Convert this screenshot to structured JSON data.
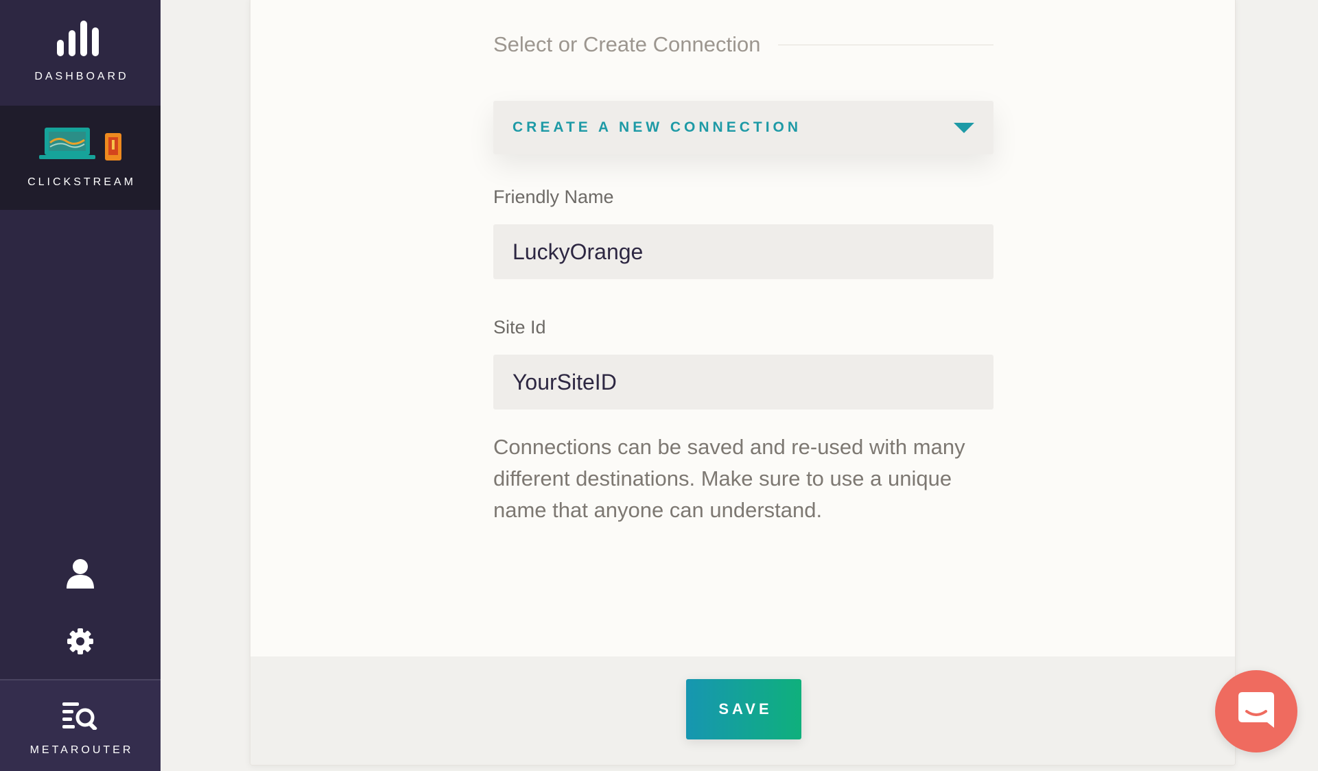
{
  "sidebar": {
    "items": [
      {
        "label": "DASHBOARD",
        "icon": "bar-chart-icon"
      },
      {
        "label": "CLICKSTREAM",
        "icon": "laptop-phone-icon",
        "active": true
      }
    ],
    "utility_icons": [
      "user-icon",
      "gear-icon"
    ],
    "footer": {
      "label": "METAROUTER",
      "icon": "list-search-icon"
    }
  },
  "form": {
    "section_title": "Select or Create Connection",
    "connection_select": {
      "value": "CREATE A NEW CONNECTION"
    },
    "friendly_name": {
      "label": "Friendly Name",
      "value": "LuckyOrange"
    },
    "site_id": {
      "label": "Site Id",
      "value": "YourSiteID"
    },
    "help_text": "Connections can be saved and re-used with many different destinations. Make sure to use a unique name that anyone can understand."
  },
  "footer": {
    "save_label": "SAVE"
  },
  "chat": {
    "icon": "chat-bubble-icon"
  },
  "colors": {
    "sidebar": "#2d2742",
    "sidebar_active": "#1f1c2b",
    "accent_teal": "#1e9aa6",
    "save_gradient_start": "#1796b1",
    "save_gradient_end": "#0fb07c",
    "chat": "#ef6b5f"
  }
}
